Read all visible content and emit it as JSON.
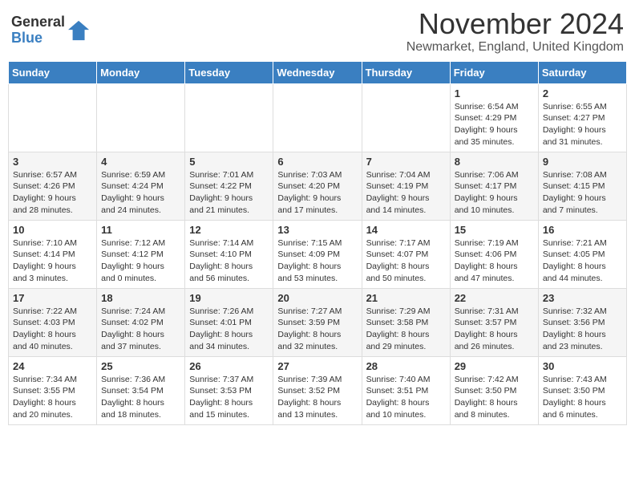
{
  "logo": {
    "general": "General",
    "blue": "Blue"
  },
  "title": "November 2024",
  "subtitle": "Newmarket, England, United Kingdom",
  "days_of_week": [
    "Sunday",
    "Monday",
    "Tuesday",
    "Wednesday",
    "Thursday",
    "Friday",
    "Saturday"
  ],
  "weeks": [
    [
      {
        "day": "",
        "info": ""
      },
      {
        "day": "",
        "info": ""
      },
      {
        "day": "",
        "info": ""
      },
      {
        "day": "",
        "info": ""
      },
      {
        "day": "",
        "info": ""
      },
      {
        "day": "1",
        "info": "Sunrise: 6:54 AM\nSunset: 4:29 PM\nDaylight: 9 hours\nand 35 minutes."
      },
      {
        "day": "2",
        "info": "Sunrise: 6:55 AM\nSunset: 4:27 PM\nDaylight: 9 hours\nand 31 minutes."
      }
    ],
    [
      {
        "day": "3",
        "info": "Sunrise: 6:57 AM\nSunset: 4:26 PM\nDaylight: 9 hours\nand 28 minutes."
      },
      {
        "day": "4",
        "info": "Sunrise: 6:59 AM\nSunset: 4:24 PM\nDaylight: 9 hours\nand 24 minutes."
      },
      {
        "day": "5",
        "info": "Sunrise: 7:01 AM\nSunset: 4:22 PM\nDaylight: 9 hours\nand 21 minutes."
      },
      {
        "day": "6",
        "info": "Sunrise: 7:03 AM\nSunset: 4:20 PM\nDaylight: 9 hours\nand 17 minutes."
      },
      {
        "day": "7",
        "info": "Sunrise: 7:04 AM\nSunset: 4:19 PM\nDaylight: 9 hours\nand 14 minutes."
      },
      {
        "day": "8",
        "info": "Sunrise: 7:06 AM\nSunset: 4:17 PM\nDaylight: 9 hours\nand 10 minutes."
      },
      {
        "day": "9",
        "info": "Sunrise: 7:08 AM\nSunset: 4:15 PM\nDaylight: 9 hours\nand 7 minutes."
      }
    ],
    [
      {
        "day": "10",
        "info": "Sunrise: 7:10 AM\nSunset: 4:14 PM\nDaylight: 9 hours\nand 3 minutes."
      },
      {
        "day": "11",
        "info": "Sunrise: 7:12 AM\nSunset: 4:12 PM\nDaylight: 9 hours\nand 0 minutes."
      },
      {
        "day": "12",
        "info": "Sunrise: 7:14 AM\nSunset: 4:10 PM\nDaylight: 8 hours\nand 56 minutes."
      },
      {
        "day": "13",
        "info": "Sunrise: 7:15 AM\nSunset: 4:09 PM\nDaylight: 8 hours\nand 53 minutes."
      },
      {
        "day": "14",
        "info": "Sunrise: 7:17 AM\nSunset: 4:07 PM\nDaylight: 8 hours\nand 50 minutes."
      },
      {
        "day": "15",
        "info": "Sunrise: 7:19 AM\nSunset: 4:06 PM\nDaylight: 8 hours\nand 47 minutes."
      },
      {
        "day": "16",
        "info": "Sunrise: 7:21 AM\nSunset: 4:05 PM\nDaylight: 8 hours\nand 44 minutes."
      }
    ],
    [
      {
        "day": "17",
        "info": "Sunrise: 7:22 AM\nSunset: 4:03 PM\nDaylight: 8 hours\nand 40 minutes."
      },
      {
        "day": "18",
        "info": "Sunrise: 7:24 AM\nSunset: 4:02 PM\nDaylight: 8 hours\nand 37 minutes."
      },
      {
        "day": "19",
        "info": "Sunrise: 7:26 AM\nSunset: 4:01 PM\nDaylight: 8 hours\nand 34 minutes."
      },
      {
        "day": "20",
        "info": "Sunrise: 7:27 AM\nSunset: 3:59 PM\nDaylight: 8 hours\nand 32 minutes."
      },
      {
        "day": "21",
        "info": "Sunrise: 7:29 AM\nSunset: 3:58 PM\nDaylight: 8 hours\nand 29 minutes."
      },
      {
        "day": "22",
        "info": "Sunrise: 7:31 AM\nSunset: 3:57 PM\nDaylight: 8 hours\nand 26 minutes."
      },
      {
        "day": "23",
        "info": "Sunrise: 7:32 AM\nSunset: 3:56 PM\nDaylight: 8 hours\nand 23 minutes."
      }
    ],
    [
      {
        "day": "24",
        "info": "Sunrise: 7:34 AM\nSunset: 3:55 PM\nDaylight: 8 hours\nand 20 minutes."
      },
      {
        "day": "25",
        "info": "Sunrise: 7:36 AM\nSunset: 3:54 PM\nDaylight: 8 hours\nand 18 minutes."
      },
      {
        "day": "26",
        "info": "Sunrise: 7:37 AM\nSunset: 3:53 PM\nDaylight: 8 hours\nand 15 minutes."
      },
      {
        "day": "27",
        "info": "Sunrise: 7:39 AM\nSunset: 3:52 PM\nDaylight: 8 hours\nand 13 minutes."
      },
      {
        "day": "28",
        "info": "Sunrise: 7:40 AM\nSunset: 3:51 PM\nDaylight: 8 hours\nand 10 minutes."
      },
      {
        "day": "29",
        "info": "Sunrise: 7:42 AM\nSunset: 3:50 PM\nDaylight: 8 hours\nand 8 minutes."
      },
      {
        "day": "30",
        "info": "Sunrise: 7:43 AM\nSunset: 3:50 PM\nDaylight: 8 hours\nand 6 minutes."
      }
    ]
  ]
}
